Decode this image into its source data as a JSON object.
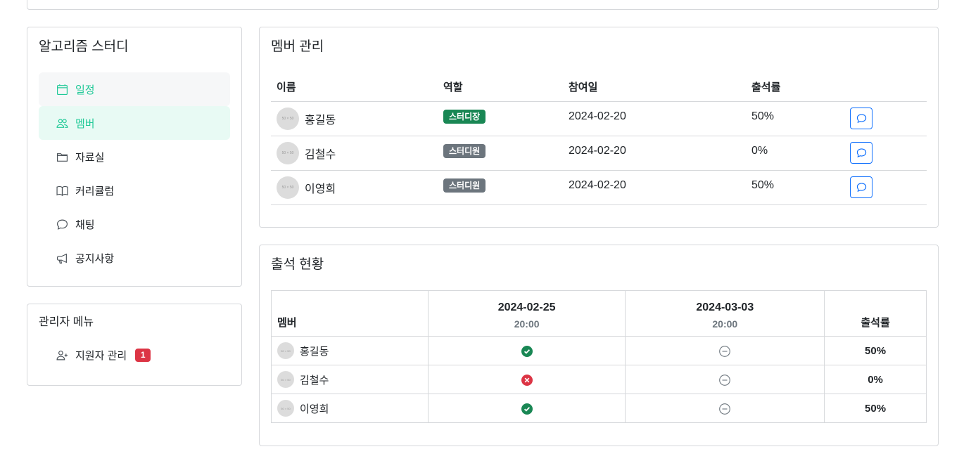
{
  "sidebar": {
    "study_title": "알고리즘 스터디",
    "items": [
      {
        "label": "일정",
        "icon": "calendar-icon"
      },
      {
        "label": "멤버",
        "icon": "people-icon"
      },
      {
        "label": "자료실",
        "icon": "folder-icon"
      },
      {
        "label": "커리큘럼",
        "icon": "book-icon"
      },
      {
        "label": "채팅",
        "icon": "chat-icon"
      },
      {
        "label": "공지사항",
        "icon": "megaphone-icon"
      }
    ],
    "accent_color": "#20c997"
  },
  "admin": {
    "title": "관리자 메뉴",
    "applicants_label": "지원자 관리",
    "applicants_count": "1"
  },
  "members": {
    "title": "멤버 관리",
    "headers": [
      "이름",
      "역할",
      "참여일",
      "출석률"
    ],
    "rows": [
      {
        "avatar": "50 × 50",
        "name": "홍길동",
        "role": "스터디장",
        "joined": "2024-02-20",
        "rate": "50%"
      },
      {
        "avatar": "50 × 50",
        "name": "김철수",
        "role": "스터디원",
        "joined": "2024-02-20",
        "rate": "0%"
      },
      {
        "avatar": "50 × 50",
        "name": "이영희",
        "role": "스터디원",
        "joined": "2024-02-20",
        "rate": "50%"
      }
    ]
  },
  "attendance": {
    "title": "출석 현황",
    "member_header": "멤버",
    "rate_header": "출석률",
    "sessions": [
      {
        "date": "2024-02-25",
        "time": "20:00"
      },
      {
        "date": "2024-03-03",
        "time": "20:00"
      }
    ],
    "rows": [
      {
        "avatar": "50 × 50",
        "name": "홍길동",
        "marks": [
          "present",
          "none"
        ],
        "rate": "50%"
      },
      {
        "avatar": "50 × 50",
        "name": "김철수",
        "marks": [
          "absent",
          "none"
        ],
        "rate": "0%"
      },
      {
        "avatar": "50 × 50",
        "name": "이영희",
        "marks": [
          "present",
          "none"
        ],
        "rate": "50%"
      }
    ],
    "colors": {
      "present": "#198754",
      "absent": "#dc3545",
      "none": "#6c757d"
    }
  }
}
